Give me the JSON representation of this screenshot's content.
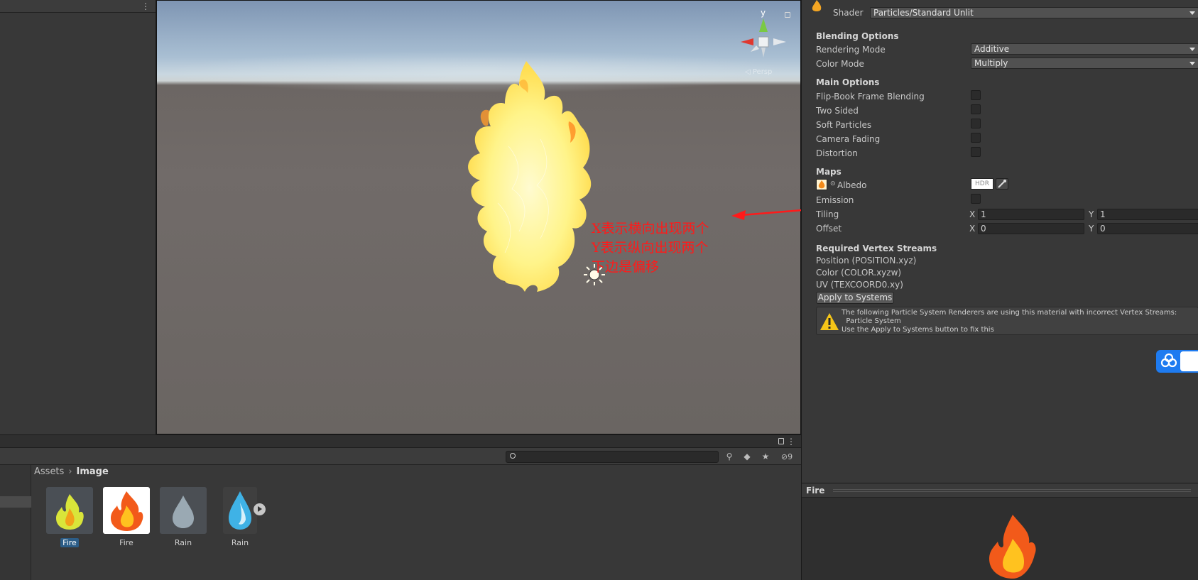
{
  "scene": {
    "gizmo_y_label": "y",
    "gizmo_projection": "◁ Persp"
  },
  "annotation": {
    "lines": [
      "X表示横向出现两个",
      "Y表示纵向出现两个",
      "下边是偏移"
    ],
    "color": "#ff1a1a"
  },
  "project": {
    "search_value": "",
    "hidden_count": "9",
    "breadcrumb": [
      "Assets",
      "Image"
    ],
    "assets": [
      {
        "label": "Fire",
        "icon": "fire-thumb",
        "selected": true
      },
      {
        "label": "Fire",
        "icon": "fire-thumb",
        "selected": false
      },
      {
        "label": "Rain",
        "icon": "drop-thumb",
        "selected": false
      },
      {
        "label": "Rain",
        "icon": "drop-thumb",
        "selected": false
      }
    ]
  },
  "inspector": {
    "shader_label": "Shader",
    "shader_value": "Particles/Standard Unlit",
    "blending_header": "Blending Options",
    "rendering_mode_label": "Rendering Mode",
    "rendering_mode_value": "Additive",
    "color_mode_label": "Color Mode",
    "color_mode_value": "Multiply",
    "main_header": "Main Options",
    "flipbook_label": "Flip-Book Frame Blending",
    "two_sided_label": "Two Sided",
    "soft_particles_label": "Soft Particles",
    "camera_fading_label": "Camera Fading",
    "distortion_label": "Distortion",
    "maps_header": "Maps",
    "albedo_label": "Albedo",
    "hdr_label": "HDR",
    "emission_label": "Emission",
    "tiling_label": "Tiling",
    "tiling_x": "1",
    "tiling_y": "1",
    "offset_label": "Offset",
    "offset_x": "0",
    "offset_y": "0",
    "axis_x": "X",
    "axis_y": "Y",
    "streams_header": "Required Vertex Streams",
    "streams": [
      "Position (POSITION.xyz)",
      "Color (COLOR.xyzw)",
      "UV (TEXCOORD0.xy)"
    ],
    "apply_button": "Apply to Systems",
    "warning_lines": [
      "The following Particle System Renderers are using this material with incorrect Vertex Streams:",
      "  Particle System",
      "Use the Apply to Systems button to fix this"
    ]
  },
  "preview": {
    "title": "Fire"
  }
}
